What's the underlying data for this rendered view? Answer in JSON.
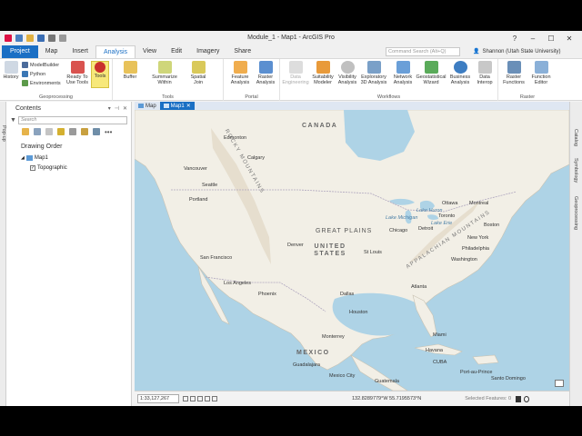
{
  "window": {
    "title": "Module_1 - Map1 - ArcGIS Pro",
    "controls": [
      "?",
      "–",
      "☐",
      "✕"
    ]
  },
  "tabs": [
    "Project",
    "Map",
    "Insert",
    "Analysis",
    "View",
    "Edit",
    "Imagery",
    "Share"
  ],
  "active_tab": "Analysis",
  "command_search": {
    "placeholder": "Command Search (Alt+Q)"
  },
  "user": {
    "name": "Shannon (Utah State University)"
  },
  "ribbon": {
    "geoprocessing": {
      "label": "Geoprocessing",
      "history": "History",
      "modelbuilder": "ModelBuilder",
      "python": "Python",
      "environments": "Environments",
      "ready_to_use": "Ready To Use Tools",
      "tools": "Tools"
    },
    "tools_group": {
      "label": "Tools",
      "buffer": "Buffer",
      "summarize_within": "Summarize Within",
      "spatial_join": "Spatial Join"
    },
    "portal": {
      "label": "Portal",
      "feature_analysis": "Feature Analysis",
      "raster_analysis": "Raster Analysis"
    },
    "workflows": {
      "label": "Workflows",
      "data_engineering": "Data Engineering",
      "suitability_modeler": "Suitability Modeler",
      "visibility_analysis": "Visibility Analysis",
      "exploratory_3d": "Exploratory 3D Analysis",
      "network_analysis": "Network Analysis",
      "geostatistical_wizard": "Geostatistical Wizard",
      "business_analysis": "Business Analysis",
      "data_interop": "Data Interop"
    },
    "raster": {
      "label": "Raster",
      "raster_functions": "Raster Functions",
      "function_editor": "Function Editor"
    }
  },
  "contents": {
    "title": "Contents",
    "search_placeholder": "Search",
    "drawing_order": "Drawing Order",
    "layers": [
      {
        "name": "Map1",
        "checked": true,
        "level": 0
      },
      {
        "name": "Topographic",
        "checked": true,
        "level": 1
      }
    ],
    "side_tab": "Pop-up"
  },
  "map_tabs": [
    "Map",
    "Map1"
  ],
  "map_labels": {
    "canada": "CANADA",
    "united_states": "UNITED STATES",
    "mexico": "MEXICO",
    "great_plains": "GREAT PLAINS",
    "rocky_mountains": "ROCKY MOUNTAINS",
    "appalachian": "APPALACHIAN MOUNTAINS",
    "cities": [
      "Edmonton",
      "Calgary",
      "Vancouver",
      "Seattle",
      "Portland",
      "Ottawa",
      "Montreal",
      "Toronto",
      "Boston",
      "Detroit",
      "Chicago",
      "New York",
      "Philadelphia",
      "Washington",
      "Denver",
      "St Louis",
      "San Francisco",
      "Los Angeles",
      "Phoenix",
      "Dallas",
      "Atlanta",
      "Houston",
      "Monterrey",
      "Miami",
      "Havana",
      "CUBA",
      "Guadalajara",
      "Mexico City",
      "Port-au-Prince",
      "Santo Domingo",
      "Guatemala",
      "Lake Huron",
      "Lake Michigan",
      "Lake Erie"
    ]
  },
  "status": {
    "scale": "1:33,127,267",
    "coordinates": "132.8289779°W 55.7195573°N",
    "selected_features": "Selected Features: 0"
  },
  "right_dock": [
    "Catalog",
    "Symbology",
    "Geoprocessing"
  ],
  "colors": {
    "project_tab": "#1a6fc4",
    "accent": "#1a6fc4",
    "water": "#aed3e6",
    "land": "#f2efe6"
  }
}
